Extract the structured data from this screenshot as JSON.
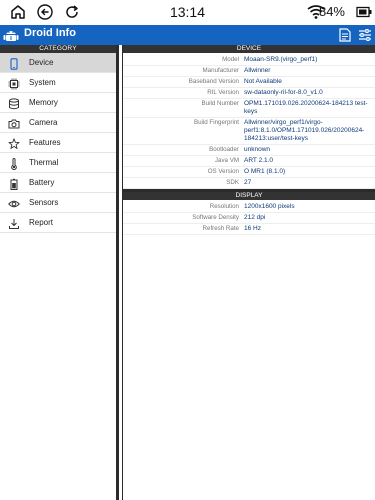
{
  "status": {
    "time": "13:14",
    "battery": "84%"
  },
  "app": {
    "title": "Droid Info"
  },
  "left": {
    "header": "CATEGORY",
    "items": [
      {
        "label": "Device",
        "icon": "phone-icon"
      },
      {
        "label": "System",
        "icon": "chip-icon"
      },
      {
        "label": "Memory",
        "icon": "database-icon"
      },
      {
        "label": "Camera",
        "icon": "camera-icon"
      },
      {
        "label": "Features",
        "icon": "features-icon"
      },
      {
        "label": "Thermal",
        "icon": "thermometer-icon"
      },
      {
        "label": "Battery",
        "icon": "battery-icon"
      },
      {
        "label": "Sensors",
        "icon": "eye-icon"
      },
      {
        "label": "Report",
        "icon": "download-icon"
      }
    ]
  },
  "device": {
    "header": "DEVICE",
    "rows": [
      {
        "key": "Model",
        "value": "Moaan-SR9.(virgo_perf1)"
      },
      {
        "key": "Manufacturer",
        "value": "Allwinner"
      },
      {
        "key": "Baseband Version",
        "value": "Not Available"
      },
      {
        "key": "RIL Version",
        "value": "sw-dataonly-ril-for-8.0_v1.0"
      },
      {
        "key": "Build Number",
        "value": "OPM1.171019.026.20200624-184213 test-keys"
      },
      {
        "key": "Build Fingerprint",
        "value": "Allwinner/virgo_perf1/virgo-perf1:8.1.0/OPM1.171019.026/20200624-184213:user/test-keys"
      },
      {
        "key": "Bootloader",
        "value": "unknown"
      },
      {
        "key": "Java VM",
        "value": "ART 2.1.0"
      },
      {
        "key": "OS Version",
        "value": "O MR1 (8.1.0)"
      },
      {
        "key": "SDK",
        "value": "27"
      }
    ]
  },
  "display": {
    "header": "DISPLAY",
    "rows": [
      {
        "key": "Resolution",
        "value": "1200x1600 pixels"
      },
      {
        "key": "Software Density",
        "value": "212 dpi"
      },
      {
        "key": "Refresh Rate",
        "value": "16 Hz"
      }
    ]
  },
  "colors": {
    "appbar": "#1565c0",
    "section_header": "#333333",
    "value_text": "#0e3a7a",
    "active_item": "#d7d7d7"
  }
}
